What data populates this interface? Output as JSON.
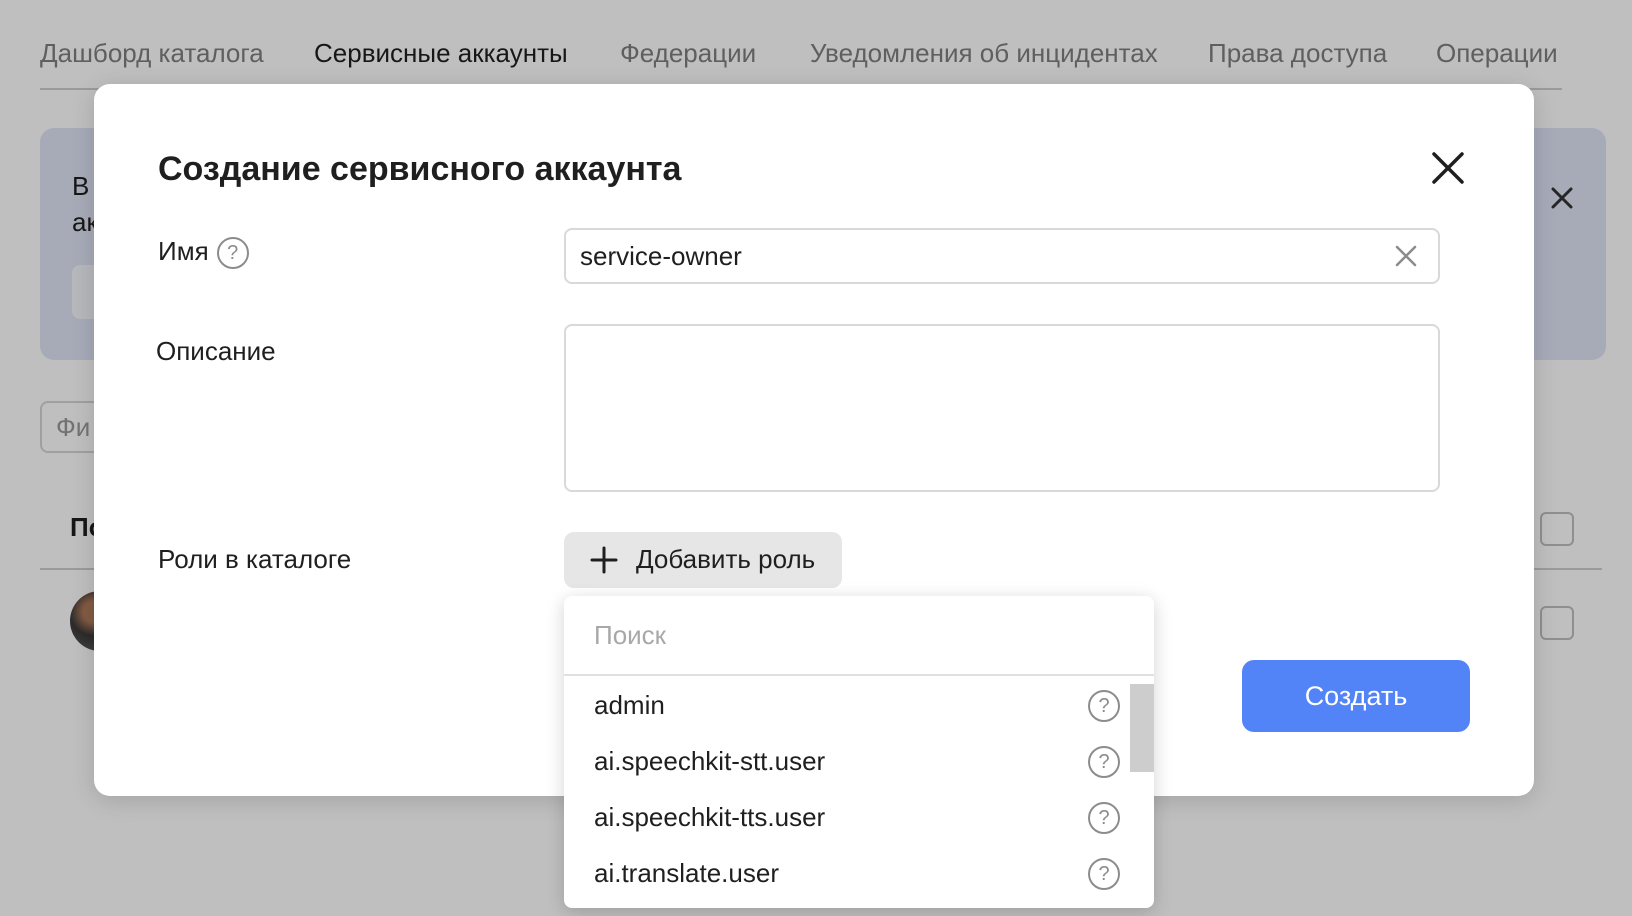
{
  "tabs": [
    {
      "label": "Дашборд каталога"
    },
    {
      "label": "Сервисные аккаунты"
    },
    {
      "label": "Федерации"
    },
    {
      "label": "Уведомления об инцидентах"
    },
    {
      "label": "Права доступа"
    },
    {
      "label": "Операции"
    }
  ],
  "background": {
    "banner_text": "В\nак",
    "filter_placeholder": "Фи",
    "table_header": "По"
  },
  "modal": {
    "title": "Создание сервисного аккаунта",
    "name_label": "Имя",
    "name_value": "service-owner",
    "description_label": "Описание",
    "description_value": "",
    "roles_label": "Роли в каталоге",
    "add_role_label": "Добавить роль",
    "create_label": "Создать",
    "help_glyph": "?"
  },
  "dropdown": {
    "search_placeholder": "Поиск",
    "roles": [
      {
        "name": "admin"
      },
      {
        "name": "ai.speechkit-stt.user"
      },
      {
        "name": "ai.speechkit-tts.user"
      },
      {
        "name": "ai.translate.user"
      }
    ]
  },
  "colors": {
    "accent": "#5283f7",
    "overlay": "rgba(0,0,0,0.25)",
    "banner": "#dfe5f6"
  }
}
